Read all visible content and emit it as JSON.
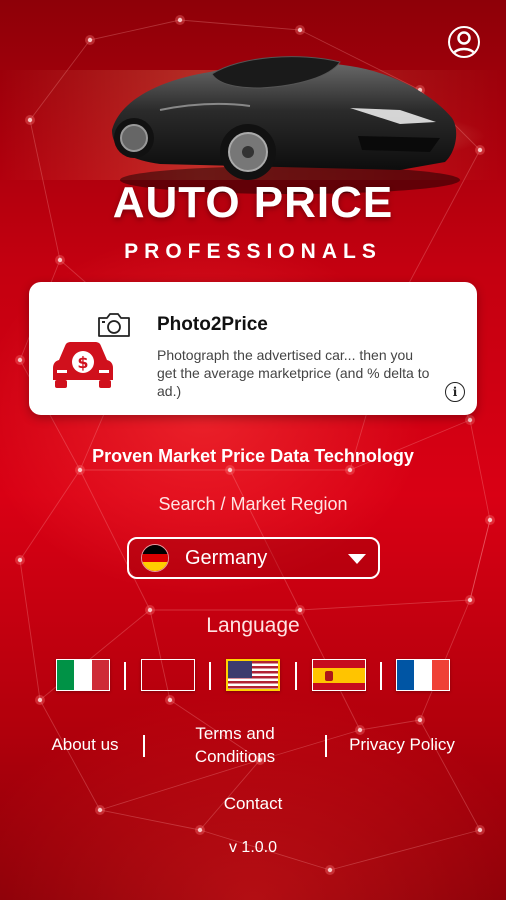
{
  "header": {
    "title": "AUTO PRICE",
    "subtitle": "PROFESSIONALS"
  },
  "card": {
    "title": "Photo2Price",
    "description": "Photograph the advertised car... then you get the average marketprice (and % delta to ad.)",
    "info_icon": "i"
  },
  "tagline": "Proven Market Price Data Technology",
  "region": {
    "label": "Search / Market Region",
    "selected": "Germany"
  },
  "language": {
    "label": "Language",
    "flags": [
      "italy-flag",
      "germany-flag",
      "usa-flag",
      "spain-flag",
      "france-flag"
    ]
  },
  "footer": {
    "about": "About us",
    "terms_line1": "Terms and",
    "terms_line2": "Conditions",
    "privacy": "Privacy Policy",
    "contact": "Contact",
    "version": "v 1.0.0"
  },
  "colors": {
    "brand_red": "#d90014",
    "card_icon_red": "#d0101c"
  }
}
